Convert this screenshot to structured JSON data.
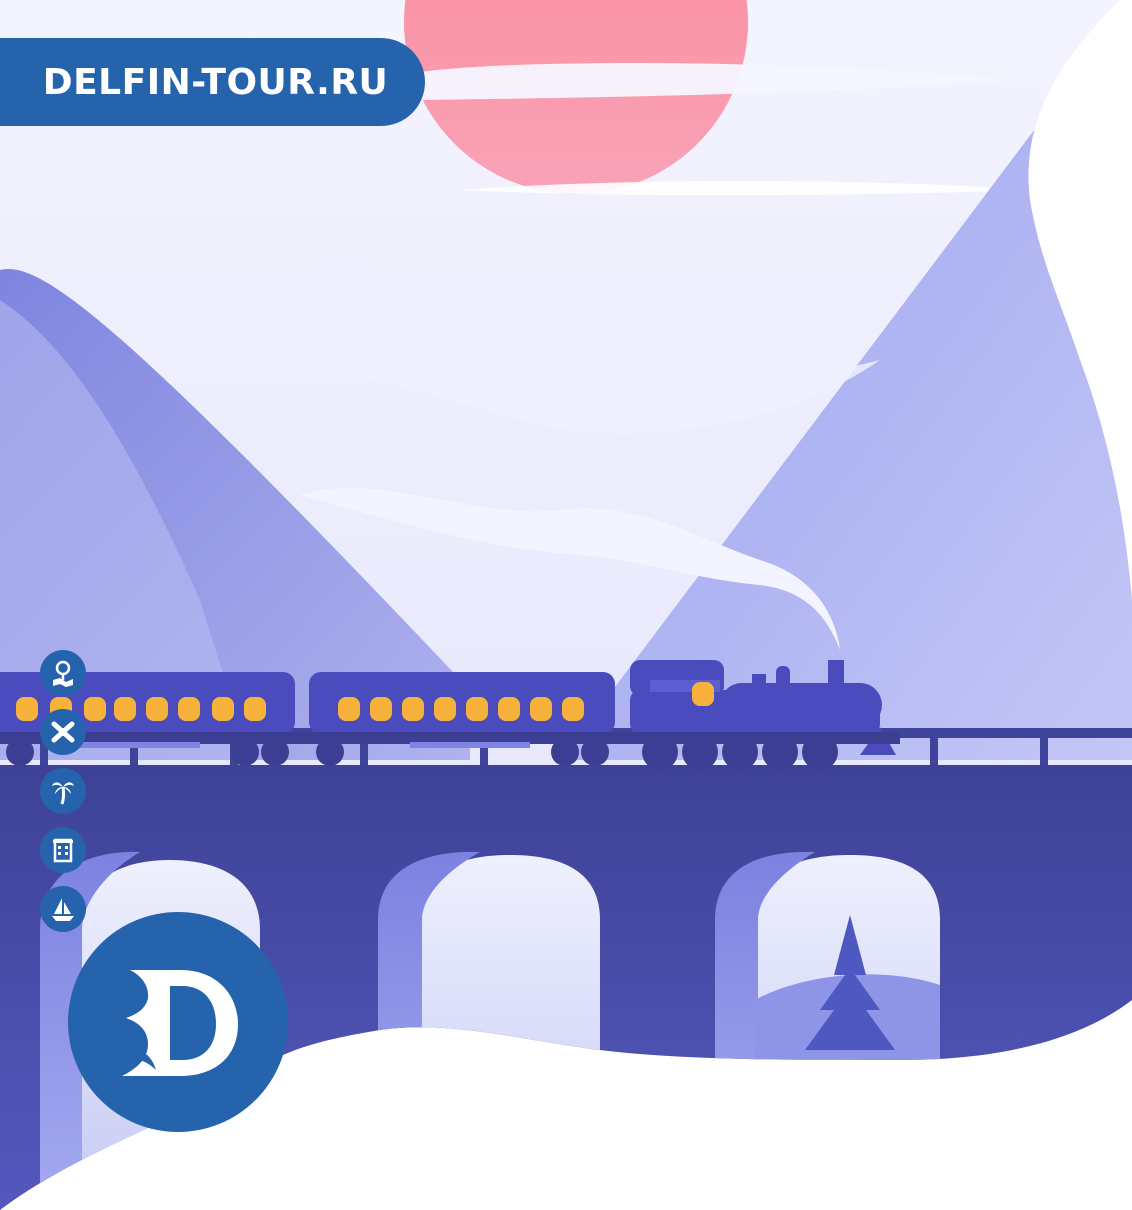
{
  "brand": {
    "site_label": "DELFIN-TOUR.RU",
    "primary_color": "#2563ac"
  },
  "nav_icons": [
    {
      "name": "map-pin-icon"
    },
    {
      "name": "airplane-icon"
    },
    {
      "name": "palm-tree-icon"
    },
    {
      "name": "hotel-icon"
    },
    {
      "name": "sailboat-icon"
    }
  ],
  "logo": {
    "letter": "D"
  },
  "colors": {
    "sun": "#f78fa0",
    "sky": "#e7e8fb",
    "mountain": "#9ea4ee",
    "bridge": "#4a4fb0",
    "train": "#4a4cbe",
    "windows": "#f6b23a"
  }
}
